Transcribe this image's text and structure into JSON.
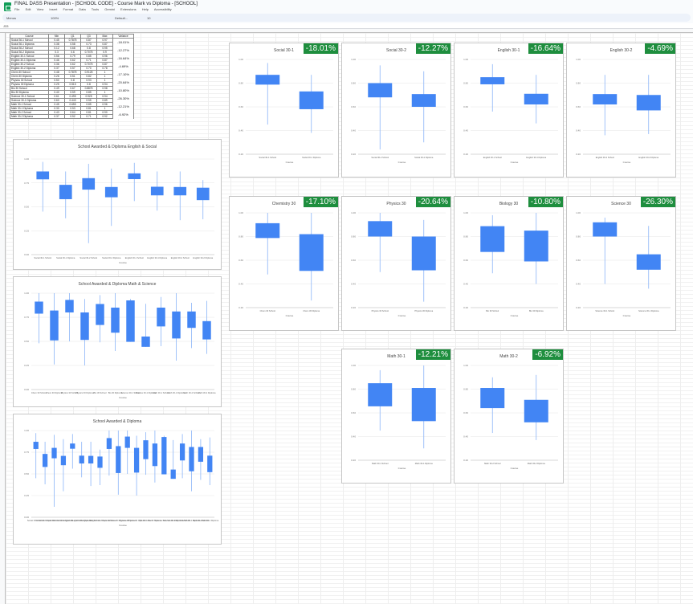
{
  "app": {
    "title": "FINAL DASS Presentation - [SCHOOL CODE] - Course Mark vs Diploma - [SCHOOL]",
    "menus": [
      "File",
      "Edit",
      "View",
      "Insert",
      "Format",
      "Data",
      "Tools",
      "Gemini",
      "Extensions",
      "Help",
      "Accessibility"
    ],
    "toolbar": {
      "menus_label": "Menus",
      "zoom": "100%",
      "font": "Default...",
      "font_size": "10"
    },
    "cell_ref": "J33"
  },
  "table": {
    "headers": [
      "Course",
      "Min",
      "Q1",
      "Q3",
      "Max",
      "Variance"
    ],
    "rows": [
      {
        "course": "Social 30-1 School",
        "min": "0.45",
        "q1": "0.7875",
        "q3": "0.87",
        "max": "0.97"
      },
      {
        "course": "Social 30-1 Diploma",
        "min": "0.38",
        "q1": "0.58",
        "q3": "0.73",
        "max": "0.87"
      },
      {
        "course": "Social 30-2 School",
        "min": "0.12",
        "q1": "0.68",
        "q3": "0.8",
        "max": "0.95"
      },
      {
        "course": "Social 30-2 Diploma",
        "min": "0.3",
        "q1": "0.6",
        "q3": "0.7075",
        "max": "0.9"
      },
      {
        "course": "English 30-1 School",
        "min": "0.56",
        "q1": "0.79",
        "q3": "0.85",
        "max": "0.96"
      },
      {
        "course": "English 30-1 Diploma",
        "min": "0.46",
        "q1": "0.62",
        "q3": "0.71",
        "max": "0.87"
      },
      {
        "course": "English 30-2 School",
        "min": "0.36",
        "q1": "0.62",
        "q3": "0.7075",
        "max": "0.87"
      },
      {
        "course": "English 30-2 Diploma",
        "min": "0.37",
        "q1": "0.57",
        "q3": "0.70",
        "max": "0.78"
      },
      {
        "course": "Chem 30 School",
        "min": "0.48",
        "q1": "0.7875",
        "q3": "0.9125",
        "max": "1"
      },
      {
        "course": "Chem 30 Diploma",
        "min": "0.26",
        "q1": "0.51",
        "q3": "0.82",
        "max": "1"
      },
      {
        "course": "Physics 30 School",
        "min": "0.50",
        "q1": "0.8",
        "q3": "0.93",
        "max": "1"
      },
      {
        "course": "Physics 30 Diploma",
        "min": "0.25",
        "q1": "0.515",
        "q3": "0.8",
        "max": "0.94"
      },
      {
        "course": "Bio 30 School",
        "min": "0.49",
        "q1": "0.67",
        "q3": "0.8875",
        "max": "0.98"
      },
      {
        "course": "Bio 30 Diploma",
        "min": "0.40",
        "q1": "0.59",
        "q3": "0.85",
        "max": "1"
      },
      {
        "course": "Science 30-1 School",
        "min": "0.61",
        "q1": "0.495",
        "q3": "0.925",
        "max": "0.94"
      },
      {
        "course": "Science 30-1 Diploma",
        "min": "0.60",
        "q1": "0.443",
        "q3": "0.55",
        "max": "0.89"
      },
      {
        "course": "Math 30-1 School",
        "min": "0.45",
        "q1": "0.655",
        "q3": "0.85",
        "max": "0.96"
      },
      {
        "course": "Math 30-1 Diploma",
        "min": "0.30",
        "q1": "0.53",
        "q3": "0.81",
        "max": "1"
      },
      {
        "course": "Math 30-2 School",
        "min": "0.43",
        "q1": "0.64",
        "q3": "0.81",
        "max": "0.90"
      },
      {
        "course": "Math 30-2 Diploma",
        "min": "0.37",
        "q1": "0.52",
        "q3": "0.71",
        "max": "0.92"
      }
    ],
    "variance": [
      "-18.01%",
      "-12.27%",
      "-16.64%",
      "-4.69%",
      "-17.10%",
      "-20.64%",
      "-10.80%",
      "-26.30%",
      "-12.21%",
      "-6.92%"
    ]
  },
  "chart_data": [
    {
      "id": "english-social",
      "type": "box",
      "title": "School Awarded & Diploma English & Social",
      "xlabel": "Course",
      "ylim": [
        0,
        1
      ],
      "categories": [
        "Social 30-1 School",
        "Social 30-1 Diploma",
        "Social 30-2 School",
        "Social 30-2 Diploma",
        "English 30-1 School",
        "English 30-1 Diploma",
        "English 30-2 School",
        "English 30-2 Diploma"
      ],
      "boxes": [
        [
          0.45,
          0.7875,
          0.87,
          0.97
        ],
        [
          0.38,
          0.58,
          0.73,
          0.87
        ],
        [
          0.12,
          0.68,
          0.8,
          0.95
        ],
        [
          0.3,
          0.6,
          0.7075,
          0.9
        ],
        [
          0.56,
          0.79,
          0.85,
          0.96
        ],
        [
          0.46,
          0.62,
          0.71,
          0.87
        ],
        [
          0.36,
          0.62,
          0.7075,
          0.87
        ],
        [
          0.37,
          0.57,
          0.7,
          0.78
        ]
      ]
    },
    {
      "id": "math-science",
      "type": "box",
      "title": "School Awarded & Diploma Math & Science",
      "xlabel": "Course",
      "ylim": [
        0,
        1
      ],
      "categories": [
        "Chem 30 School",
        "Chem 30 Diploma",
        "Physics 30 School",
        "Physics 30 Diploma",
        "Bio 30 School",
        "Bio 30 Diploma",
        "Science 30-1 School",
        "Science 30-1 Diploma",
        "Math 30-1 School",
        "Math 30-1 Diploma",
        "Math 30-2 School",
        "Math 30-2 Diploma"
      ],
      "boxes": [
        [
          0.48,
          0.7875,
          0.9125,
          1
        ],
        [
          0.26,
          0.51,
          0.82,
          1
        ],
        [
          0.5,
          0.8,
          0.93,
          1
        ],
        [
          0.25,
          0.515,
          0.8,
          0.94
        ],
        [
          0.49,
          0.67,
          0.8875,
          0.98
        ],
        [
          0.4,
          0.59,
          0.85,
          1
        ],
        [
          0.61,
          0.495,
          0.925,
          0.94
        ],
        [
          0.6,
          0.443,
          0.55,
          0.89
        ],
        [
          0.45,
          0.655,
          0.85,
          0.96
        ],
        [
          0.3,
          0.53,
          0.81,
          1
        ],
        [
          0.43,
          0.64,
          0.81,
          0.9
        ],
        [
          0.37,
          0.52,
          0.71,
          0.92
        ]
      ]
    },
    {
      "id": "all-courses",
      "type": "box",
      "title": "School Awarded & Diploma",
      "xlabel": "Course",
      "ylim": [
        0,
        1
      ],
      "categories": [
        "Social 30-1 School",
        "Social 30-1 Diploma",
        "Social 30-2 School",
        "Social 30-2 Diploma",
        "English 30-1 School",
        "English 30-1 Diploma",
        "English 30-2 School",
        "English 30-2 Diploma",
        "Chem 30 School",
        "Chem 30 Diploma",
        "Physics 30 School",
        "Physics 30 Diploma",
        "Bio 30 School",
        "Bio 30 Diploma",
        "Science 30-1 School",
        "Science 30-1 Diploma",
        "Math 30-1 School",
        "Math 30-1 Diploma",
        "Math 30-2 School",
        "Math 30-2 Diploma"
      ],
      "boxes": [
        [
          0.45,
          0.7875,
          0.87,
          0.97
        ],
        [
          0.38,
          0.58,
          0.73,
          0.87
        ],
        [
          0.12,
          0.68,
          0.8,
          0.95
        ],
        [
          0.3,
          0.6,
          0.7075,
          0.9
        ],
        [
          0.56,
          0.79,
          0.85,
          0.96
        ],
        [
          0.46,
          0.62,
          0.71,
          0.87
        ],
        [
          0.36,
          0.62,
          0.7075,
          0.87
        ],
        [
          0.37,
          0.57,
          0.7,
          0.78
        ],
        [
          0.48,
          0.7875,
          0.9125,
          1
        ],
        [
          0.26,
          0.51,
          0.82,
          1
        ],
        [
          0.5,
          0.8,
          0.93,
          1
        ],
        [
          0.25,
          0.515,
          0.8,
          0.94
        ],
        [
          0.49,
          0.67,
          0.8875,
          0.98
        ],
        [
          0.4,
          0.59,
          0.85,
          1
        ],
        [
          0.61,
          0.495,
          0.925,
          0.94
        ],
        [
          0.6,
          0.443,
          0.55,
          0.89
        ],
        [
          0.45,
          0.655,
          0.85,
          0.96
        ],
        [
          0.3,
          0.53,
          0.81,
          1
        ],
        [
          0.43,
          0.64,
          0.81,
          0.9
        ],
        [
          0.37,
          0.52,
          0.71,
          0.92
        ]
      ]
    },
    {
      "id": "social-30-1",
      "type": "box",
      "title": "Social 30-1",
      "badge": "-18.01%",
      "xlabel": "Course",
      "ylim": [
        0.2,
        1
      ],
      "categories": [
        "Social 30-1 School",
        "Social 30-1 Diploma"
      ],
      "boxes": [
        [
          0.45,
          0.7875,
          0.87,
          0.97
        ],
        [
          0.38,
          0.58,
          0.73,
          0.87
        ]
      ]
    },
    {
      "id": "social-30-2",
      "type": "box",
      "title": "Social 30-2",
      "badge": "-12.27%",
      "xlabel": "Course",
      "ylim": [
        0.2,
        1
      ],
      "categories": [
        "Social 30-2 School",
        "Social 30-2 Diploma"
      ],
      "boxes": [
        [
          0.24,
          0.68,
          0.8,
          0.95
        ],
        [
          0.3,
          0.6,
          0.7075,
          0.9
        ]
      ]
    },
    {
      "id": "english-30-1",
      "type": "box",
      "title": "English 30-1",
      "badge": "-16.64%",
      "xlabel": "Course",
      "ylim": [
        0.2,
        1
      ],
      "categories": [
        "English 30-1 School",
        "English 30-1 Diploma"
      ],
      "boxes": [
        [
          0.56,
          0.79,
          0.85,
          0.96
        ],
        [
          0.46,
          0.62,
          0.71,
          0.87
        ]
      ]
    },
    {
      "id": "english-30-2",
      "type": "box",
      "title": "English 30-2",
      "badge": "-4.69%",
      "xlabel": "Course",
      "ylim": [
        0.2,
        1
      ],
      "categories": [
        "English 30-2 School",
        "English 30-2 Diploma"
      ],
      "boxes": [
        [
          0.36,
          0.62,
          0.7075,
          0.87
        ],
        [
          0.37,
          0.57,
          0.7,
          0.87
        ]
      ]
    },
    {
      "id": "chemistry-30",
      "type": "box",
      "title": "Chemistry 30",
      "badge": "-17.10%",
      "xlabel": "Course",
      "ylim": [
        0.2,
        1
      ],
      "categories": [
        "Chem 30 School",
        "Chem 30 Diploma"
      ],
      "boxes": [
        [
          0.48,
          0.7875,
          0.9125,
          1
        ],
        [
          0.26,
          0.51,
          0.82,
          1
        ]
      ]
    },
    {
      "id": "physics-30",
      "type": "box",
      "title": "Physics 30",
      "badge": "-20.64%",
      "xlabel": "Course",
      "ylim": [
        0.2,
        1
      ],
      "categories": [
        "Physics 30 School",
        "Physics 30 Diploma"
      ],
      "boxes": [
        [
          0.5,
          0.8,
          0.93,
          1
        ],
        [
          0.25,
          0.515,
          0.8,
          0.94
        ]
      ]
    },
    {
      "id": "biology-30",
      "type": "box",
      "title": "Biology 30",
      "badge": "-10.80%",
      "xlabel": "Course",
      "ylim": [
        0.2,
        1
      ],
      "categories": [
        "Bio 30 School",
        "Bio 30 Diploma"
      ],
      "boxes": [
        [
          0.49,
          0.67,
          0.8875,
          0.98
        ],
        [
          0.4,
          0.59,
          0.85,
          1
        ]
      ]
    },
    {
      "id": "science-30",
      "type": "box",
      "title": "Science 30",
      "badge": "-26.30%",
      "xlabel": "Course",
      "ylim": [
        0.2,
        1
      ],
      "categories": [
        "Science 30-1 School",
        "Science 30-1 Diploma"
      ],
      "boxes": [
        [
          0.4,
          0.8,
          0.92,
          0.96
        ],
        [
          0.36,
          0.52,
          0.65,
          0.89
        ]
      ]
    },
    {
      "id": "math-30-1",
      "type": "box",
      "title": "Math 30-1",
      "badge": "-12.21%",
      "xlabel": "Course",
      "ylim": [
        0.2,
        1
      ],
      "categories": [
        "Math 30-1 School",
        "Math 30-1 Diploma"
      ],
      "boxes": [
        [
          0.45,
          0.655,
          0.85,
          0.96
        ],
        [
          0.3,
          0.53,
          0.81,
          1
        ]
      ]
    },
    {
      "id": "math-30-2",
      "type": "box",
      "title": "Math 30-2",
      "badge": "-6.92%",
      "xlabel": "Course",
      "ylim": [
        0.2,
        1
      ],
      "categories": [
        "Math 30-2 School",
        "Math 30-2 Diploma"
      ],
      "boxes": [
        [
          0.43,
          0.64,
          0.81,
          0.9
        ],
        [
          0.37,
          0.52,
          0.71,
          0.92
        ]
      ]
    }
  ],
  "colors": {
    "box": "#4285f4",
    "whisker": "#8ab4f8",
    "badge": "#1e8e3e"
  }
}
